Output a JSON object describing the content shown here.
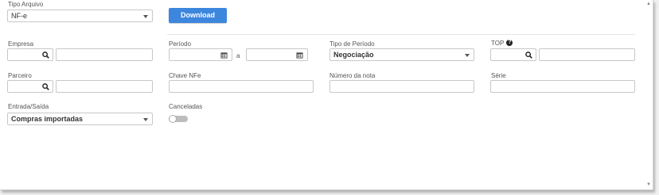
{
  "form": {
    "tipo_arquivo": {
      "label": "Tipo Arquivo",
      "value": "NF-e"
    },
    "download_label": "Download",
    "empresa": {
      "label": "Empresa",
      "code": "",
      "name": ""
    },
    "periodo": {
      "label": "Período",
      "start": "",
      "separator": "a",
      "end": ""
    },
    "tipo_periodo": {
      "label": "Tipo de Período",
      "value": "Negociação"
    },
    "top": {
      "label": "TOP",
      "help": "?",
      "code": "",
      "name": ""
    },
    "parceiro": {
      "label": "Parceiro",
      "code": "",
      "name": ""
    },
    "chave_nfe": {
      "label": "Chave NFe",
      "value": ""
    },
    "numero_nota": {
      "label": "Número da nota",
      "value": ""
    },
    "serie": {
      "label": "Série",
      "value": ""
    },
    "entrada_saida": {
      "label": "Entrada/Saída",
      "value": "Compras importadas"
    },
    "canceladas": {
      "label": "Canceladas",
      "enabled": false
    }
  },
  "icons": {
    "search": "magnifier-icon",
    "calendar": "calendar-icon",
    "dropdown": "chevron-down-icon",
    "help": "question-circle-icon"
  },
  "colors": {
    "primary_button": "#3d86de",
    "toggle_off": "#bdbdbd"
  }
}
